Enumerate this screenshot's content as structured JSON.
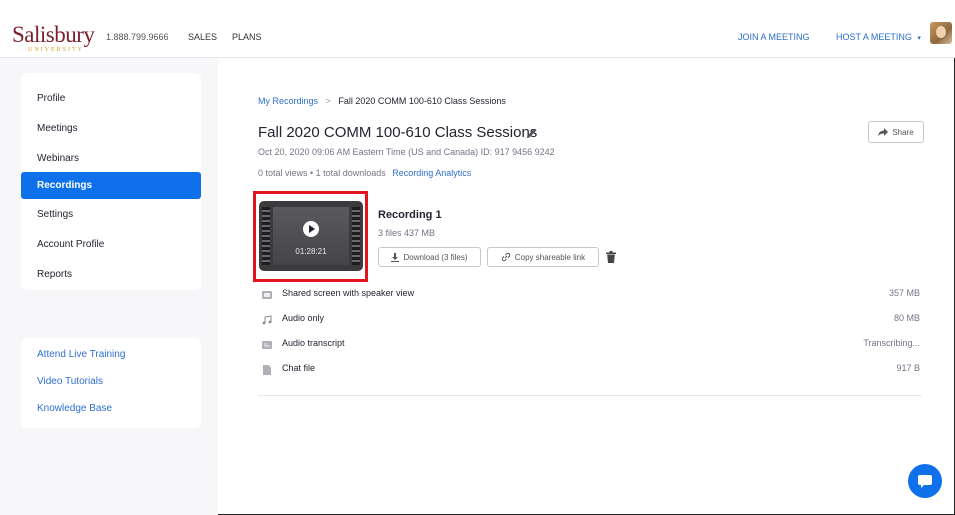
{
  "header": {
    "logo": "Salisbury",
    "logo_sub": "UNIVERSITY",
    "phone": "1.888.799.9666",
    "sales": "SALES",
    "plans": "PLANS",
    "join_meeting": "JOIN A MEETING",
    "host_meeting": "HOST A MEETING",
    "host_caret": "▾"
  },
  "sidebar": {
    "items": [
      {
        "label": "Profile"
      },
      {
        "label": "Meetings"
      },
      {
        "label": "Webinars"
      },
      {
        "label": "Recordings",
        "active": true
      },
      {
        "label": "Settings"
      },
      {
        "label": "Account Profile"
      },
      {
        "label": "Reports"
      }
    ],
    "links": [
      {
        "label": "Attend Live Training"
      },
      {
        "label": "Video Tutorials"
      },
      {
        "label": "Knowledge Base"
      }
    ]
  },
  "main": {
    "breadcrumb": {
      "root": "My Recordings",
      "sep": ">",
      "current": "Fall 2020 COMM 100-610 Class Sessions"
    },
    "title": "Fall 2020 COMM 100-610 Class Sessions",
    "share_label": "Share",
    "meta": "Oct 20, 2020 09:06 AM Eastern Time (US and Canada)   ID: 917 9456 9242",
    "stats": "0 total views • 1 total downloads",
    "analytics_link": "Recording Analytics",
    "recording": {
      "name": "Recording 1",
      "files_summary": "3 files  437 MB",
      "duration": "01:28:21",
      "download_label": "Download (3 files)",
      "copy_link_label": "Copy shareable link"
    },
    "files": [
      {
        "name": "Shared screen with speaker view",
        "size": "357 MB",
        "icon": "video-icon"
      },
      {
        "name": "Audio only",
        "size": "80 MB",
        "icon": "music-note-icon"
      },
      {
        "name": "Audio transcript",
        "size": "Transcribing...",
        "icon": "transcript-icon"
      },
      {
        "name": "Chat file",
        "size": "917 B",
        "icon": "file-icon"
      }
    ]
  },
  "colors": {
    "accent": "#0e71eb",
    "link": "#2d6fd0",
    "highlight": "#e0141d",
    "brand": "#7a1f2b"
  }
}
